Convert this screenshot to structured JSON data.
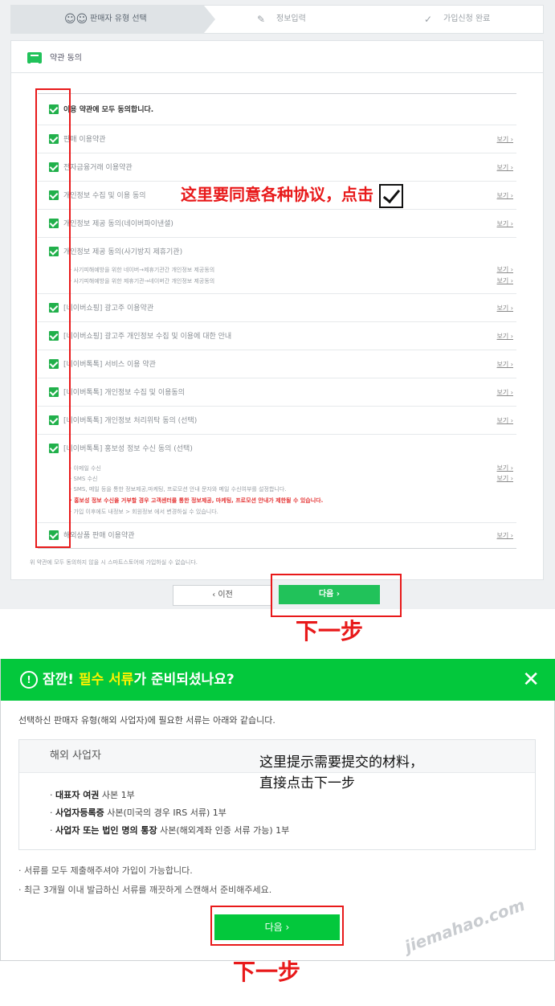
{
  "steps": [
    {
      "label": "판매자 유형 선택",
      "active": true
    },
    {
      "label": "정보입력",
      "active": false
    },
    {
      "label": "가입신청 완료",
      "active": false
    }
  ],
  "terms": {
    "section_title": "약관 동의",
    "all_agree": "이용 약관에 모두 동의합니다.",
    "view_label": "보기 ›",
    "items": [
      "판매 이용약관",
      "전자금융거래 이용약관",
      "개인정보 수집 및 이용 동의",
      "개인정보 제공 동의(네이버파이낸셜)",
      "개인정보 제공 동의(사기방지 제휴기관)",
      "[네이버쇼핑] 광고주 이용약관",
      "[네이버쇼핑] 광고주 개인정보 수집 및 이용에 대한 안내",
      "[네이버톡톡] 서비스 이용 약관",
      "[네이버톡톡] 개인정보 수집 및 이용동의",
      "[네이버톡톡] 개인정보 처리위탁 동의 (선택)",
      "[네이버톡톡] 홍보성 정보 수신 동의 (선택)",
      "해외상품 판매 이용약관"
    ],
    "fraud_sub": [
      "· 사기피해예방을 위한 네이버→제휴기관간 개인정보 제공동의",
      "· 사기피해예방을 위한 제휴기관→네이버간 개인정보 제공동의"
    ],
    "promo_sub": [
      "· 이메일 수신",
      "· SMS 수신",
      "· SMS, 메일 등을 통한 정보제공,마케팅, 프로모션 안내 문자와 메일 수신여부를 설정합니다.",
      "· 홍보성 정보 수신을 거부할 경우 고객센터를 통한 정보제공, 마케팅, 프로모션 안내가 제한될 수 있습니다.",
      "· 가입 이후에도 내정보 > 회원정보 에서 변경하실 수 있습니다."
    ],
    "footnote": "위 약관에 모두 동의하지 않을 시 스마트스토어에 가입하실 수 없습니다.",
    "prev_button": "‹ 이전",
    "next_button": "다음 ›"
  },
  "annotations": {
    "agree_hint": "这里要同意各种协议，点击",
    "next_step_top": "下一步",
    "docs_hint_1": "这里提示需要提交的材料，",
    "docs_hint_2": "直接点击下一步",
    "next_step_bottom": "下一步"
  },
  "modal": {
    "info_icon": "!",
    "title_prefix": "잠깐! ",
    "title_highlight": "필수 서류",
    "title_suffix": "가 준비되셨나요?",
    "close_icon": "✕",
    "description": "선택하신 판매자 유형(해외 사업자)에 필요한 서류는 아래와 같습니다.",
    "box_title": "해외 사업자",
    "docs": [
      {
        "bold": "대표자 여권",
        "rest": " 사본 1부"
      },
      {
        "bold": "사업자등록증",
        "rest": " 사본(미국의 경우 IRS 서류) 1부"
      },
      {
        "bold": "사업자 또는 법인 명의 통장",
        "rest": " 사본(해외계좌 인증 서류 가능) 1부"
      }
    ],
    "notes": [
      "· 서류를 모두 제출해주셔야 가입이 가능합니다.",
      "· 최근 3개월 이내 발급하신 서류를 깨끗하게 스캔해서 준비해주세요."
    ],
    "next_button": "다음 ›"
  },
  "watermark": "jiemahao.com",
  "colors": {
    "green": "#03c83c",
    "check_green": "#21b04b",
    "annotation_red": "#e8191a"
  }
}
